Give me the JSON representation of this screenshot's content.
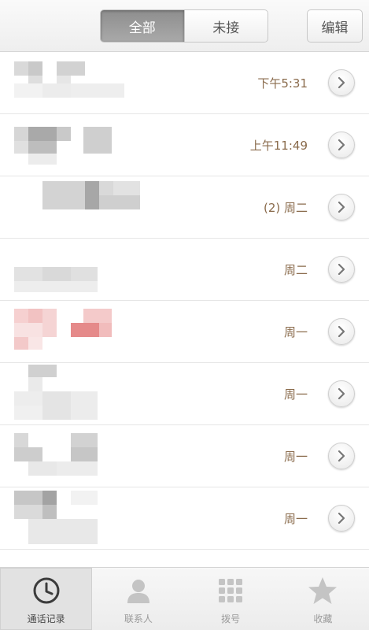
{
  "header": {
    "segments": [
      "全部",
      "未接"
    ],
    "active_segment": 0,
    "edit_label": "编辑"
  },
  "calls": [
    {
      "time": "下午5:31",
      "name_tone": "gray"
    },
    {
      "time": "上午11:49",
      "name_tone": "gray"
    },
    {
      "time": "(2) 周二",
      "name_tone": "gray"
    },
    {
      "time": "周二",
      "name_tone": "gray"
    },
    {
      "time": "周一",
      "name_tone": "red"
    },
    {
      "time": "周一",
      "name_tone": "gray"
    },
    {
      "time": "周一",
      "name_tone": "gray"
    },
    {
      "time": "周一",
      "name_tone": "gray"
    }
  ],
  "tabs": [
    {
      "label": "通话记录",
      "icon": "clock-icon",
      "active": true
    },
    {
      "label": "联系人",
      "icon": "person-icon",
      "active": false
    },
    {
      "label": "拨号",
      "icon": "keypad-icon",
      "active": false
    },
    {
      "label": "收藏",
      "icon": "star-icon",
      "active": false
    }
  ],
  "colors": {
    "time_text": "#8a6b4c",
    "missed_tint": "#e58a8a",
    "active_segment": "#9a9a9a"
  }
}
